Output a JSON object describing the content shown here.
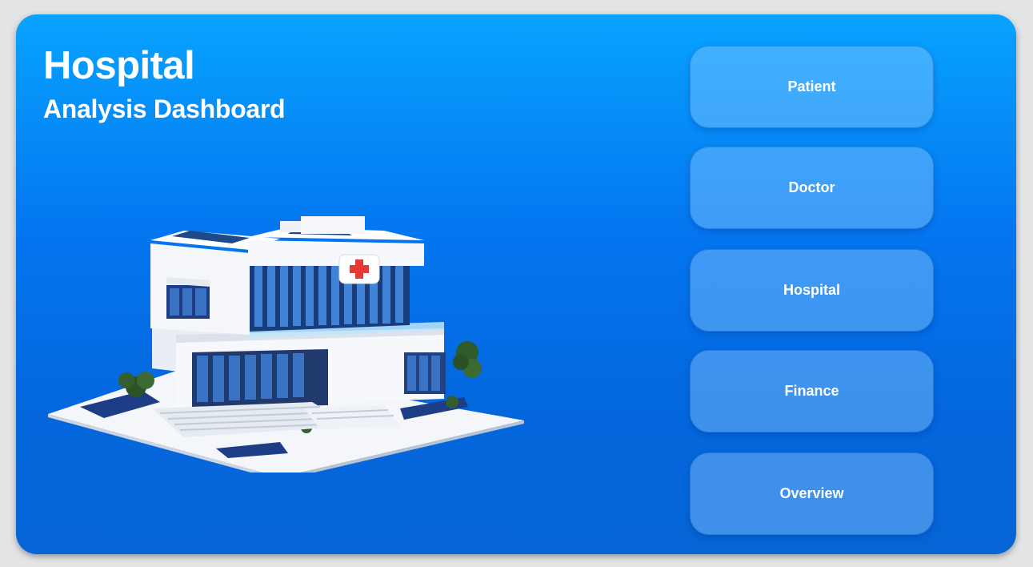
{
  "header": {
    "title": "Hospital",
    "subtitle": "Analysis Dashboard"
  },
  "illustration": {
    "icon": "hospital-building-illustration",
    "accent_cross_color": "#e53935"
  },
  "nav": {
    "items": [
      {
        "label": "Patient"
      },
      {
        "label": "Doctor"
      },
      {
        "label": "Hospital"
      },
      {
        "label": "Finance"
      },
      {
        "label": "Overview"
      }
    ]
  },
  "colors": {
    "background": "#e3e4e6",
    "panel_top": "#07a3ff",
    "panel_bottom": "#0565d6",
    "text": "#ffffff"
  }
}
